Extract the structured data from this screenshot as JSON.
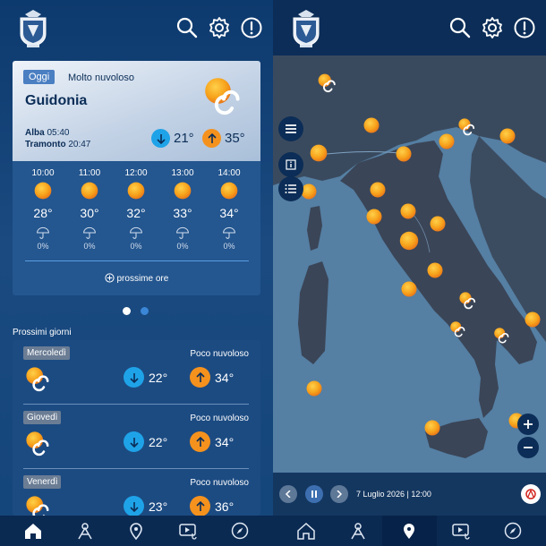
{
  "today_card": {
    "badge": "Oggi",
    "condition": "Molto nuvoloso",
    "city": "Guidonia",
    "sunrise_label": "Alba",
    "sunrise_time": "05:40",
    "sunset_label": "Tramonto",
    "sunset_time": "20:47",
    "temp_min": "21°",
    "temp_max": "35°",
    "hourly": [
      {
        "time": "10:00",
        "temp": "28°",
        "precip": "0%"
      },
      {
        "time": "11:00",
        "temp": "30°",
        "precip": "0%"
      },
      {
        "time": "12:00",
        "temp": "32°",
        "precip": "0%"
      },
      {
        "time": "13:00",
        "temp": "33°",
        "precip": "0%"
      },
      {
        "time": "14:00",
        "temp": "34°",
        "precip": "0%"
      }
    ],
    "more_hours": "prossime ore"
  },
  "next_days": {
    "title": "Prossimi giorni",
    "days": [
      {
        "name": "Mercoledì",
        "condition": "Poco nuvoloso",
        "min": "22°",
        "max": "34°"
      },
      {
        "name": "Giovedì",
        "condition": "Poco nuvoloso",
        "min": "22°",
        "max": "34°"
      },
      {
        "name": "Venerdì",
        "condition": "Poco nuvoloso",
        "min": "23°",
        "max": "36°"
      }
    ]
  },
  "map_timebar": {
    "label": "7 Luglio 2026 | 12:00"
  },
  "colors": {
    "arrow_down": "#1fa3e8",
    "arrow_up": "#f5921e",
    "accent": "#4a7fc2",
    "sun": "#f7a21b"
  },
  "icons": {
    "top": [
      "search-icon",
      "settings-gear-icon",
      "info-icon"
    ],
    "nav": [
      "home-icon",
      "weather-station-icon",
      "map-pin-icon",
      "video-forecast-icon",
      "compass-icon"
    ],
    "map_tools": [
      "layers-menu-icon",
      "legend-info-icon",
      "list-icon",
      "zoom-in-icon",
      "zoom-out-icon"
    ]
  },
  "pager": {
    "pages": 2,
    "active": 1
  }
}
